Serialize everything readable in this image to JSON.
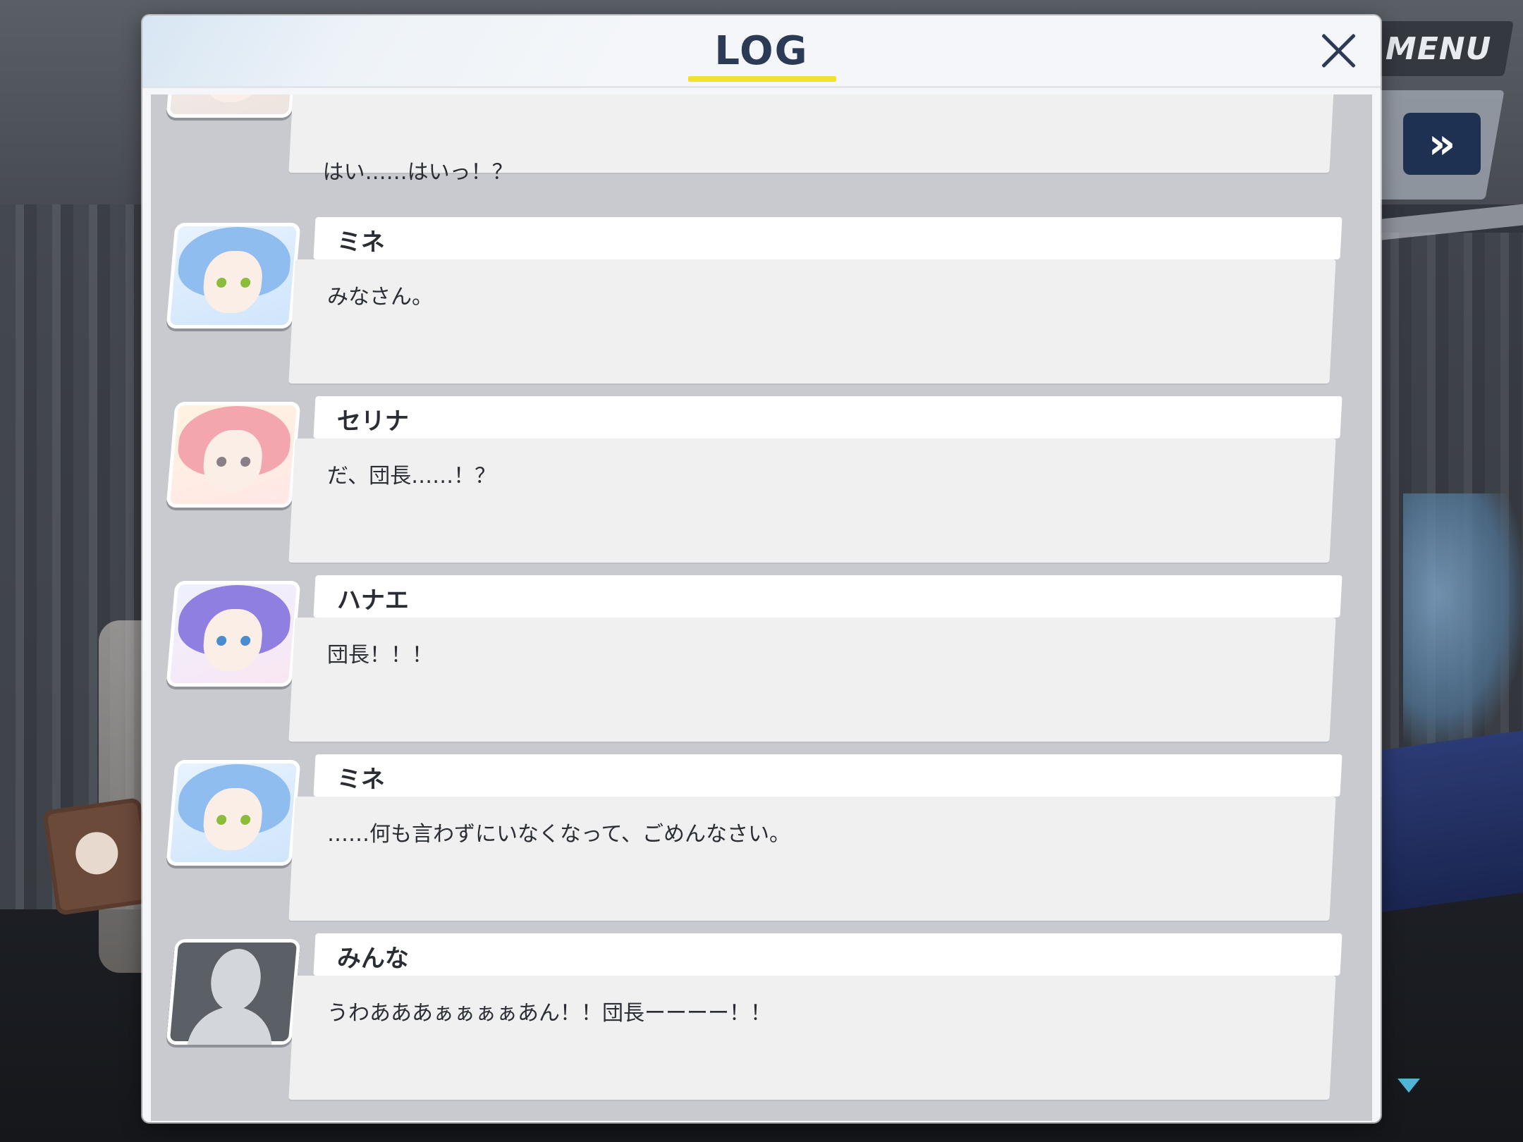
{
  "controls": {
    "menu_label": "MENU",
    "skip_icon": "double-chevron-right-icon",
    "skip_glyph": "»"
  },
  "log": {
    "title": "LOG",
    "close_icon": "close-icon",
    "entries": [
      {
        "speaker": "",
        "avatar": "grey-haired-girl",
        "text": "はい……はいっ！？"
      },
      {
        "speaker": "ミネ",
        "avatar": "mine-portrait",
        "text": "みなさん。"
      },
      {
        "speaker": "セリナ",
        "avatar": "serina-portrait",
        "text": "だ、団長……！？"
      },
      {
        "speaker": "ハナエ",
        "avatar": "hanae-portrait",
        "text": "団長！！！"
      },
      {
        "speaker": "ミネ",
        "avatar": "mine-portrait",
        "text": "……何も言わずにいなくなって、ごめんなさい。"
      },
      {
        "speaker": "みんな",
        "avatar": "silhouette-placeholder",
        "text": "うわあああぁぁぁぁあん！！団長ーーーー！！"
      }
    ]
  },
  "colors": {
    "title_color": "#2b3a55",
    "title_underline": "#f3e02e",
    "skip_button_bg": "#1f3152",
    "scroll_arrow": "#4fb4d6"
  }
}
